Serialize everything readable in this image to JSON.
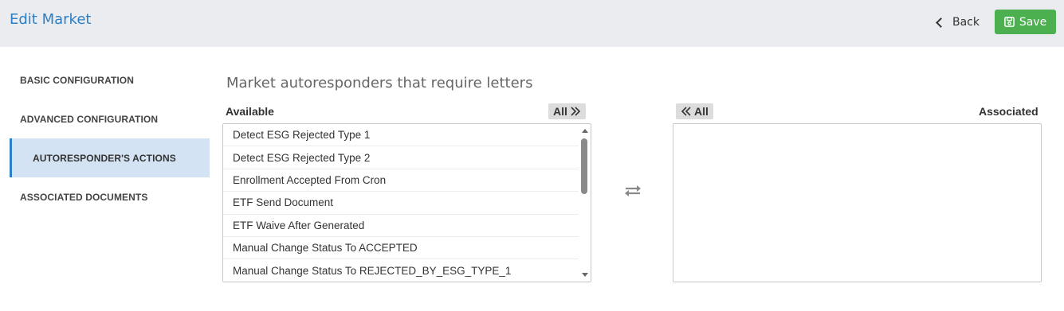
{
  "header": {
    "title": "Edit Market",
    "back_label": "Back",
    "save_label": "Save",
    "save_color": "#4caf50",
    "title_color": "#2c7fc6"
  },
  "sidebar": {
    "items": [
      {
        "label": "BASIC CONFIGURATION",
        "active": false
      },
      {
        "label": "ADVANCED CONFIGURATION",
        "active": false
      },
      {
        "label": "AUTORESPONDER'S ACTIONS",
        "active": true
      },
      {
        "label": "ASSOCIATED DOCUMENTS",
        "active": false
      }
    ]
  },
  "main": {
    "section_title": "Market autoresponders that require letters",
    "available_label": "Available",
    "associated_label": "Associated",
    "move_all_right_label": "All",
    "move_all_left_label": "All",
    "available_items": [
      "Detect ESG Rejected Type 1",
      "Detect ESG Rejected Type 2",
      "Enrollment Accepted From Cron",
      "ETF Send Document",
      "ETF Waive After Generated",
      "Manual Change Status To ACCEPTED",
      "Manual Change Status To REJECTED_BY_ESG_TYPE_1"
    ],
    "associated_items": []
  }
}
